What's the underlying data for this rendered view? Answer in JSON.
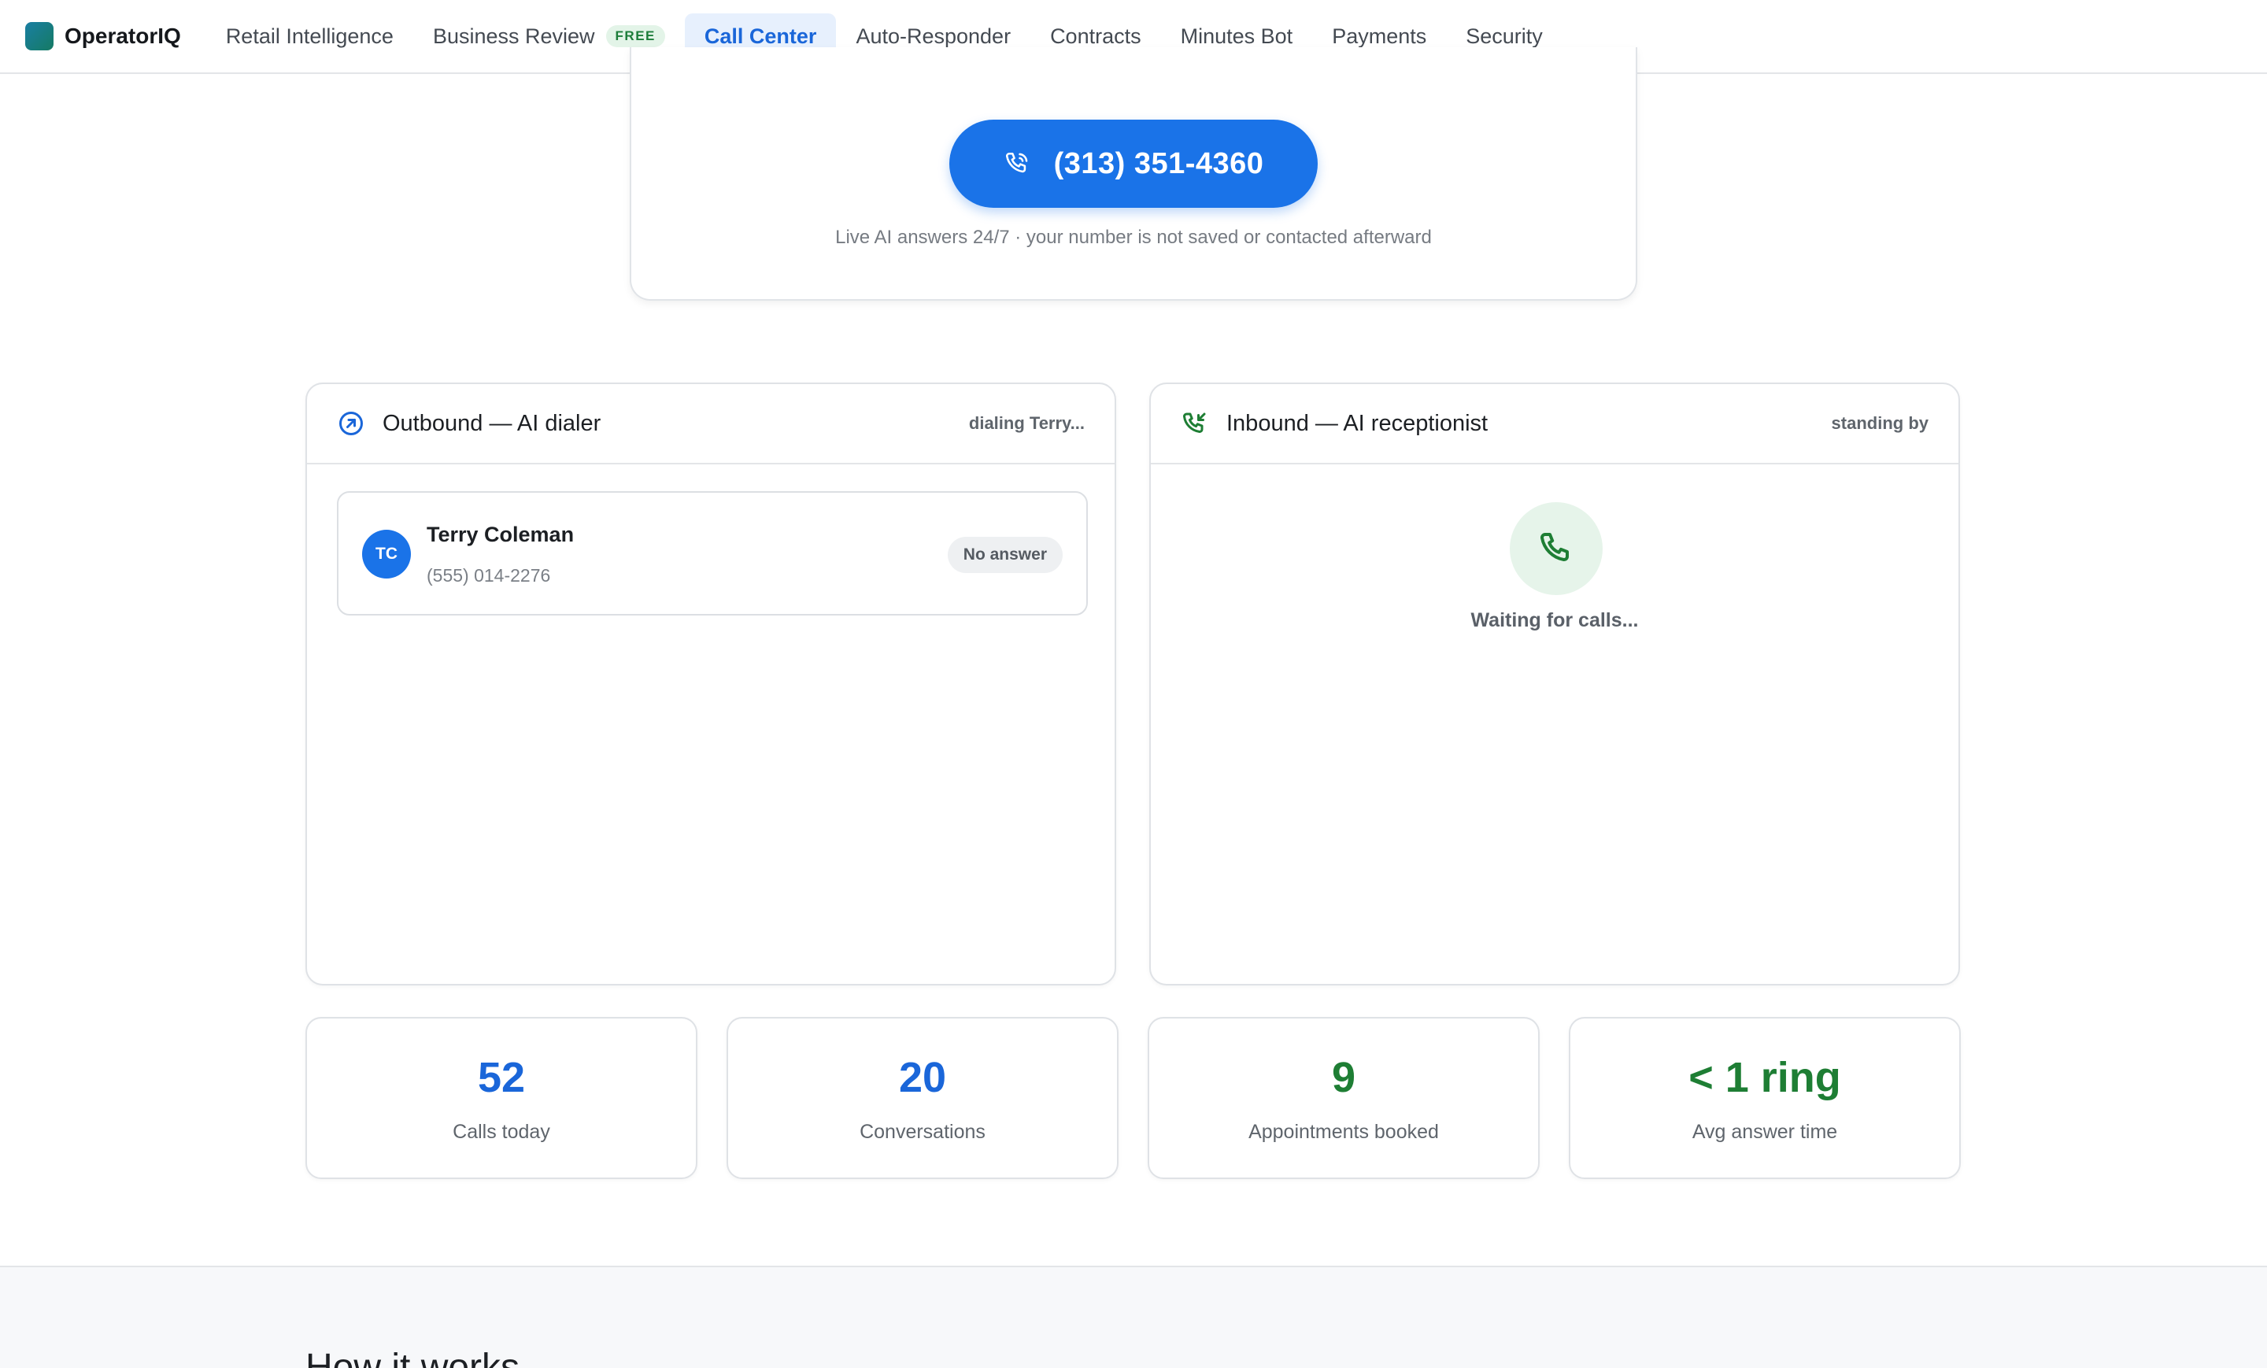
{
  "app": {
    "name": "OperatorIQ"
  },
  "nav": {
    "items": [
      {
        "label": "Retail Intelligence"
      },
      {
        "label": "Business Review",
        "badge": "FREE"
      },
      {
        "label": "Call Center",
        "active": true
      },
      {
        "label": "Auto-Responder"
      },
      {
        "label": "Contracts"
      },
      {
        "label": "Minutes Bot"
      },
      {
        "label": "Payments"
      },
      {
        "label": "Security"
      }
    ]
  },
  "hero": {
    "phone_number": "(313) 351-4360",
    "note": "Live AI answers 24/7 · your number is not saved or contacted afterward",
    "call_icon": "phone-ringing-icon"
  },
  "outbound": {
    "title": "Outbound — AI dialer",
    "status": "dialing Terry...",
    "icon": "arrow-up-right-circle-icon",
    "call": {
      "initials": "TC",
      "name": "Terry Coleman",
      "phone": "(555) 014-2276",
      "status": "No answer"
    }
  },
  "inbound": {
    "title": "Inbound — AI receptionist",
    "status": "standing by",
    "icon": "phone-incoming-icon",
    "waiting_text": "Waiting for calls...",
    "waiting_icon": "phone-icon"
  },
  "stats": [
    {
      "value": "52",
      "label": "Calls today",
      "color": "#1a66d9"
    },
    {
      "value": "20",
      "label": "Conversations",
      "color": "#1a66d9"
    },
    {
      "value": "9",
      "label": "Appointments booked",
      "color": "#1e7e34"
    },
    {
      "value": "< 1 ring",
      "label": "Avg answer time",
      "color": "#1e7e34"
    }
  ],
  "how_it_works": {
    "heading": "How it works"
  },
  "colors": {
    "accent": "#1a73e8",
    "success": "#1e7e34",
    "success_bg": "#e6f4ea"
  }
}
